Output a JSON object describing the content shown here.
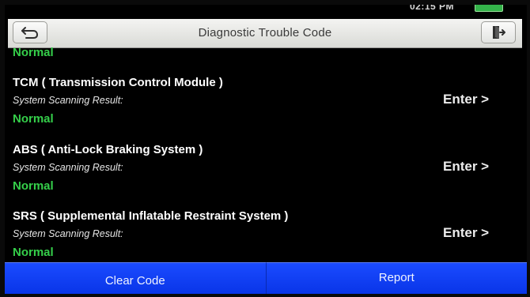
{
  "status_bar": {
    "time": "02:15 PM"
  },
  "header": {
    "title": "Diagnostic Trouble Code"
  },
  "top_partial_status": "Normal",
  "modules": [
    {
      "title": "TCM ( Transmission Control Module )",
      "subtitle": "System Scanning Result:",
      "result": "Normal",
      "action": "Enter >"
    },
    {
      "title": "ABS ( Anti-Lock Braking System )",
      "subtitle": "System Scanning Result:",
      "result": "Normal",
      "action": "Enter >"
    },
    {
      "title": "SRS ( Supplemental Inflatable Restraint System )",
      "subtitle": "System Scanning Result:",
      "result": "Normal",
      "action": "Enter >"
    }
  ],
  "footer": {
    "clear_label": "Clear Code",
    "report_label": "Report"
  },
  "colors": {
    "accent": "#1b4bff",
    "ok": "#35cf4a",
    "header_bg": "#e6e7e3"
  },
  "icons": {
    "back": "back-arrow-icon",
    "exit": "exit-icon"
  }
}
